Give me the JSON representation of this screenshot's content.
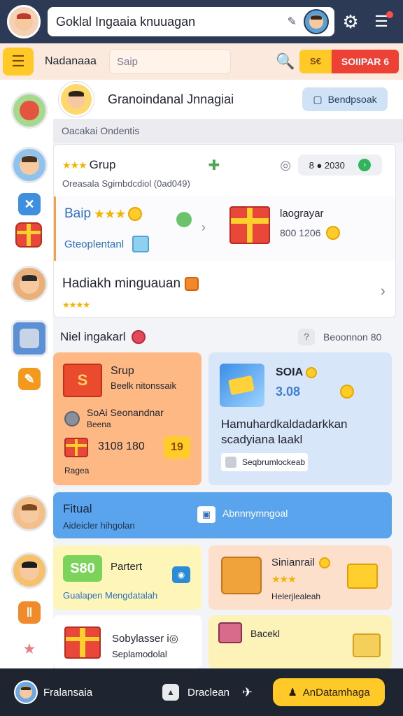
{
  "topbar": {
    "title": "Goklal Ingaaia knuuagan",
    "edit_glyph": "✎",
    "gear_glyph": "⚙",
    "notif_glyph": "☰"
  },
  "subbar": {
    "menu_glyph": "☰",
    "label": "Nadanaaa",
    "search_placeholder": "Saip",
    "search_glyph": "🔍",
    "pill_yellow": "S€",
    "pill_red": "SOIIPAR 6"
  },
  "rail": {
    "small1": "✕",
    "small2": "",
    "small3": "✎",
    "small4": "‖",
    "small5": "★"
  },
  "group_header": {
    "title": "Granoindanal Jnnagiai",
    "button_label": "Bendpsoak",
    "button_glyph": "▢"
  },
  "section_label": "Oacakai Ondentis",
  "group_card": {
    "stars": "★★★",
    "name": "Grup",
    "puzzle_glyph": "✚",
    "target_glyph": "◎",
    "chip_text": "8 ● 2030",
    "chip_ok": "›",
    "subtitle": "Oreasala Sgimbdcdiol (0ad049)",
    "bap_label": "Baip",
    "bap_stars": "★★★",
    "explore_label": "Gteoplentanl",
    "chevron": "›",
    "reward_title": "laograyar",
    "reward_value": "800 1206",
    "gift_title": "Hadiakh minguauan",
    "gift_stars": "★★★★",
    "gift_chevron": "›"
  },
  "events": {
    "title": "Niel ingakarl",
    "q_glyph": "?",
    "right_label": "Beoonnon 80"
  },
  "card_orange": {
    "icon_text": "S",
    "title": "Srup",
    "subtitle": "Beelk nitonssaik",
    "line3": "SoAi Seonandnar",
    "line4": "Beena",
    "value": "3108 180",
    "badge": "19",
    "footer": "Ragea"
  },
  "card_blue": {
    "title": "SOIA",
    "value": "3.08",
    "body": "Hamuhardkaldadarkkan scadyiana laakl",
    "chip": "Seqbrumlockeab"
  },
  "banner": {
    "title": "Fitual",
    "subtitle": "Aideicler hihgolan",
    "icon": "▣",
    "right_text": "Abnnnymngoal"
  },
  "card_yellow": {
    "badge": "S80",
    "title": "Partert",
    "cam": "◉",
    "footer": "Gualapen Mengdatalah"
  },
  "card_peach": {
    "title": "Sinianrail",
    "stars": "★★★",
    "footer": "Helerjlealeah"
  },
  "card_white": {
    "title": "Sobylasser",
    "title_suffix": "i◎",
    "subtitle": "Seplamodolal"
  },
  "card_lemon": {
    "title": "Bacekl"
  },
  "bottombar": {
    "left_label": "Fralansaia",
    "lock_glyph": "▲",
    "mid_label": "Draclean",
    "pin_glyph": "✈",
    "cta_glyph": "♟",
    "cta_label": "AnDatamhaga"
  }
}
